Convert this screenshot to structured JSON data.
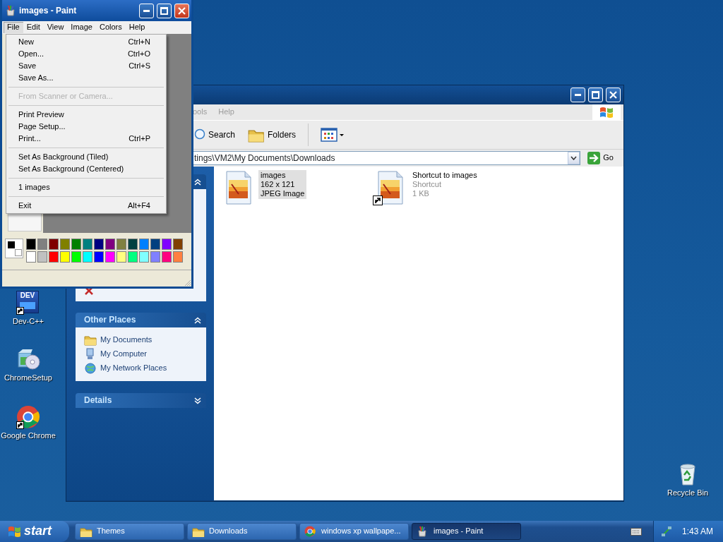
{
  "desktop_icons": [
    {
      "label": "Dev-C++",
      "kind": "devcpp",
      "icon_text": "DEV",
      "shortcut": true
    },
    {
      "label": "ChromeSetup",
      "kind": "setup",
      "shortcut": false
    },
    {
      "label": "Google Chrome",
      "kind": "chrome",
      "shortcut": true
    },
    {
      "label": "Recycle Bin",
      "kind": "recycle",
      "shortcut": false
    }
  ],
  "explorer_window": {
    "menu": [
      "ools",
      "Help"
    ],
    "toolbar": [
      {
        "kind": "search",
        "label": "Search"
      },
      {
        "kind": "folders",
        "label": "Folders"
      },
      {
        "kind": "views"
      }
    ],
    "address": "tings\\VM2\\My Documents\\Downloads",
    "go_label": "Go",
    "panels": [
      {
        "expanded": true
      },
      {
        "title": "Other Places",
        "expanded": true,
        "items": [
          {
            "label": "My Documents",
            "kind": "folder"
          },
          {
            "label": "My Computer",
            "kind": "computer"
          },
          {
            "label": "My Network Places",
            "kind": "network"
          }
        ]
      },
      {
        "title": "Details",
        "expanded": false
      }
    ],
    "files": [
      {
        "name": "images",
        "details": [
          "162 x 121",
          "JPEG Image"
        ],
        "kind": "image",
        "selected": true
      },
      {
        "name": "Shortcut to images",
        "details": [
          "Shortcut",
          "1 KB"
        ],
        "kind": "shortcut",
        "selected": false
      }
    ]
  },
  "paint_window": {
    "title": "images - Paint",
    "menu": [
      {
        "label": "File",
        "selected": true
      },
      {
        "label": "Edit",
        "selected": false
      },
      {
        "label": "View",
        "selected": false
      },
      {
        "label": "Image",
        "selected": false
      },
      {
        "label": "Colors",
        "selected": false
      },
      {
        "label": "Help",
        "selected": false
      }
    ],
    "file_menu": [
      {
        "kind": "item",
        "label": "New",
        "shortcut": "Ctrl+N",
        "disabled": false
      },
      {
        "kind": "item",
        "label": "Open...",
        "shortcut": "Ctrl+O",
        "disabled": false
      },
      {
        "kind": "item",
        "label": "Save",
        "shortcut": "Ctrl+S",
        "disabled": false
      },
      {
        "kind": "item",
        "label": "Save As...",
        "disabled": false
      },
      {
        "kind": "separator"
      },
      {
        "kind": "item",
        "label": "From Scanner or Camera...",
        "disabled": true
      },
      {
        "kind": "separator"
      },
      {
        "kind": "item",
        "label": "Print Preview",
        "disabled": false
      },
      {
        "kind": "item",
        "label": "Page Setup...",
        "disabled": false
      },
      {
        "kind": "item",
        "label": "Print...",
        "shortcut": "Ctrl+P",
        "disabled": false
      },
      {
        "kind": "separator"
      },
      {
        "kind": "item",
        "label": "Set As Background (Tiled)",
        "disabled": false
      },
      {
        "kind": "item",
        "label": "Set As Background (Centered)",
        "disabled": false
      },
      {
        "kind": "separator"
      },
      {
        "kind": "item",
        "label": "1 images",
        "disabled": false
      },
      {
        "kind": "separator"
      },
      {
        "kind": "item",
        "label": "Exit",
        "shortcut": "Alt+F4",
        "disabled": false
      }
    ],
    "current_colors": [
      {
        "color": "#000000"
      },
      {
        "color": "#ffffff"
      }
    ],
    "palette": [
      {
        "color": "#000000"
      },
      {
        "color": "#808080"
      },
      {
        "color": "#800000"
      },
      {
        "color": "#808000"
      },
      {
        "color": "#008000"
      },
      {
        "color": "#008080"
      },
      {
        "color": "#000080"
      },
      {
        "color": "#800080"
      },
      {
        "color": "#808040"
      },
      {
        "color": "#004040"
      },
      {
        "color": "#0080ff"
      },
      {
        "color": "#004080"
      },
      {
        "color": "#8000ff"
      },
      {
        "color": "#804000"
      },
      {
        "color": "#ffffff"
      },
      {
        "color": "#c0c0c0"
      },
      {
        "color": "#ff0000"
      },
      {
        "color": "#ffff00"
      },
      {
        "color": "#00ff00"
      },
      {
        "color": "#00ffff"
      },
      {
        "color": "#0000ff"
      },
      {
        "color": "#ff00ff"
      },
      {
        "color": "#ffff80"
      },
      {
        "color": "#00ff80"
      },
      {
        "color": "#80ffff"
      },
      {
        "color": "#8080ff"
      },
      {
        "color": "#ff0080"
      },
      {
        "color": "#ff8040"
      }
    ]
  },
  "taskbar": {
    "start_label": "start",
    "tasks": [
      {
        "label": "Themes",
        "kind": "folder",
        "selected": false
      },
      {
        "label": "Downloads",
        "kind": "folder",
        "selected": false
      },
      {
        "label": "windows xp wallpape...",
        "kind": "chrome",
        "selected": false
      },
      {
        "label": "images - Paint",
        "kind": "paint",
        "selected": true
      }
    ],
    "clock": "1:43 AM"
  }
}
